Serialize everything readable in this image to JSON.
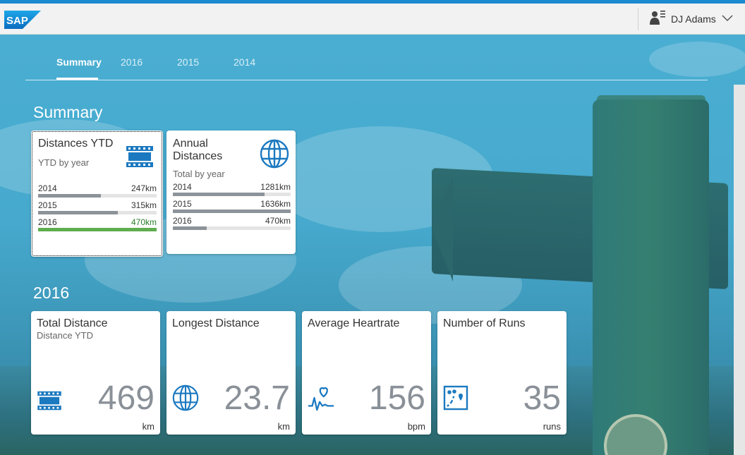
{
  "shell": {
    "logo_text": "SAP",
    "user_name": "DJ Adams"
  },
  "tabs": [
    {
      "label": "Summary",
      "selected": true
    },
    {
      "label": "2016",
      "selected": false
    },
    {
      "label": "2015",
      "selected": false
    },
    {
      "label": "2014",
      "selected": false
    }
  ],
  "sections": {
    "summary_title": "Summary",
    "year_title": "2016"
  },
  "tiles": {
    "distances_ytd": {
      "title": "Distances YTD",
      "subtitle": "YTD by year",
      "icon": "film-strip-icon",
      "bars": [
        {
          "label": "2014",
          "value": "247km",
          "fraction": 0.53
        },
        {
          "label": "2015",
          "value": "315km",
          "fraction": 0.67
        },
        {
          "label": "2016",
          "value": "470km",
          "fraction": 1.0,
          "status": "good"
        }
      ]
    },
    "annual_distances": {
      "title_line1": "Annual",
      "title_line2": "Distances",
      "subtitle": "Total by year",
      "icon": "globe-icon",
      "bars": [
        {
          "label": "2014",
          "value": "1281km",
          "fraction": 0.78
        },
        {
          "label": "2015",
          "value": "1636km",
          "fraction": 1.0
        },
        {
          "label": "2016",
          "value": "470km",
          "fraction": 0.29
        }
      ]
    },
    "total_distance": {
      "title": "Total Distance",
      "subtitle": "Distance YTD",
      "value": "469",
      "unit": "km",
      "icon": "film-strip-icon"
    },
    "longest_distance": {
      "title": "Longest Distance",
      "value": "23.7",
      "unit": "km",
      "icon": "globe-icon"
    },
    "average_heartrate": {
      "title": "Average Heartrate",
      "value": "156",
      "unit": "bpm",
      "icon": "heart-rate-icon"
    },
    "number_of_runs": {
      "title": "Number of Runs",
      "value": "35",
      "unit": "runs",
      "icon": "route-map-icon"
    }
  },
  "colors": {
    "brand_blue": "#1b8ad1",
    "icon_blue": "#1b79c0",
    "good_green": "#5ead4e",
    "neutral_bar": "#8c9399"
  }
}
